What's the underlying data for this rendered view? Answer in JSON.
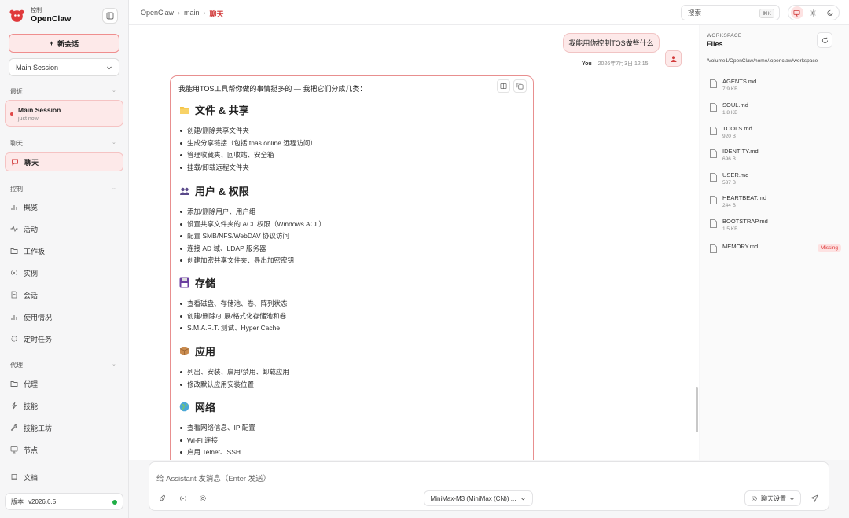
{
  "brand": {
    "subtitle": "控制",
    "name": "OpenClaw"
  },
  "sidebar": {
    "new_chat_label": "新会话",
    "session_select": "Main Session",
    "recent_heading": "最近",
    "recent_item": {
      "title": "Main Session",
      "subtitle": "just now"
    },
    "chat_heading": "聊天",
    "chat_item": "聊天",
    "control_heading": "控制",
    "control_items": [
      "概览",
      "活动",
      "工作板",
      "实例",
      "会话",
      "使用情况",
      "定时任务"
    ],
    "agent_heading": "代理",
    "agent_items": [
      "代理",
      "技能",
      "技能工坊",
      "节点"
    ],
    "docs_label": "文档",
    "version_label": "版本",
    "version_value": "v2026.6.5"
  },
  "topbar": {
    "breadcrumb": [
      "OpenClaw",
      "main",
      "聊天"
    ],
    "search_label": "搜索",
    "search_shortcut": "⌘K"
  },
  "chat": {
    "user_message": "我能用你控制TOS做些什么",
    "user_name": "You",
    "user_time": "2026年7月3日 12:15",
    "assistant_intro": "我能用TOS工具帮你做的事情挺多的 — 我把它们分成几类：",
    "sections": [
      {
        "icon": "folder-icon",
        "title": "文件 & 共享",
        "items": [
          "创建/删除共享文件夹",
          "生成分享链接（包括 tnas.online 远程访问）",
          "管理收藏夹、回收站、安全箱",
          "挂载/卸载远程文件夹"
        ]
      },
      {
        "icon": "users-icon",
        "title": "用户 & 权限",
        "items": [
          "添加/删除用户、用户组",
          "设置共享文件夹的 ACL 权限（Windows ACL）",
          "配置 SMB/NFS/WebDAV 协议访问",
          "连接 AD 域、LDAP 服务器",
          "创建加密共享文件夹、导出加密密钥"
        ]
      },
      {
        "icon": "floppy-icon",
        "title": "存储",
        "items": [
          "查看磁盘、存储池、卷、阵列状态",
          "创建/删除/扩展/格式化存储池和卷",
          "S.M.A.R.T. 测试、Hyper Cache"
        ]
      },
      {
        "icon": "package-icon",
        "title": "应用",
        "items": [
          "列出、安装、启用/禁用、卸载应用",
          "修改默认应用安装位置"
        ]
      },
      {
        "icon": "globe-icon",
        "title": "网络",
        "items": [
          "查看网络信息、IP 配置",
          "Wi-Fi 连接",
          "启用 Telnet、SSH"
        ]
      }
    ]
  },
  "composer": {
    "placeholder": "给 Assistant 发消息（Enter 发送）",
    "model": "MiniMax-M3 (MiniMax (CN)) ...",
    "settings_label": "聊天设置"
  },
  "workspace": {
    "label": "WORKSPACE",
    "title": "Files",
    "path": "/Volume1/OpenClaw/home/.openclaw/workspace",
    "files": [
      {
        "name": "AGENTS.md",
        "size": "7.9 KB"
      },
      {
        "name": "SOUL.md",
        "size": "1.8 KB"
      },
      {
        "name": "TOOLS.md",
        "size": "920 B"
      },
      {
        "name": "IDENTITY.md",
        "size": "696 B"
      },
      {
        "name": "USER.md",
        "size": "537 B"
      },
      {
        "name": "HEARTBEAT.md",
        "size": "244 B"
      },
      {
        "name": "BOOTSTRAP.md",
        "size": "1.5 KB"
      },
      {
        "name": "MEMORY.md",
        "size": "",
        "badge": "Missing"
      }
    ]
  },
  "colors": {
    "accent": "#e04848",
    "accent_soft": "#fde9e9",
    "online": "#1fae46"
  }
}
